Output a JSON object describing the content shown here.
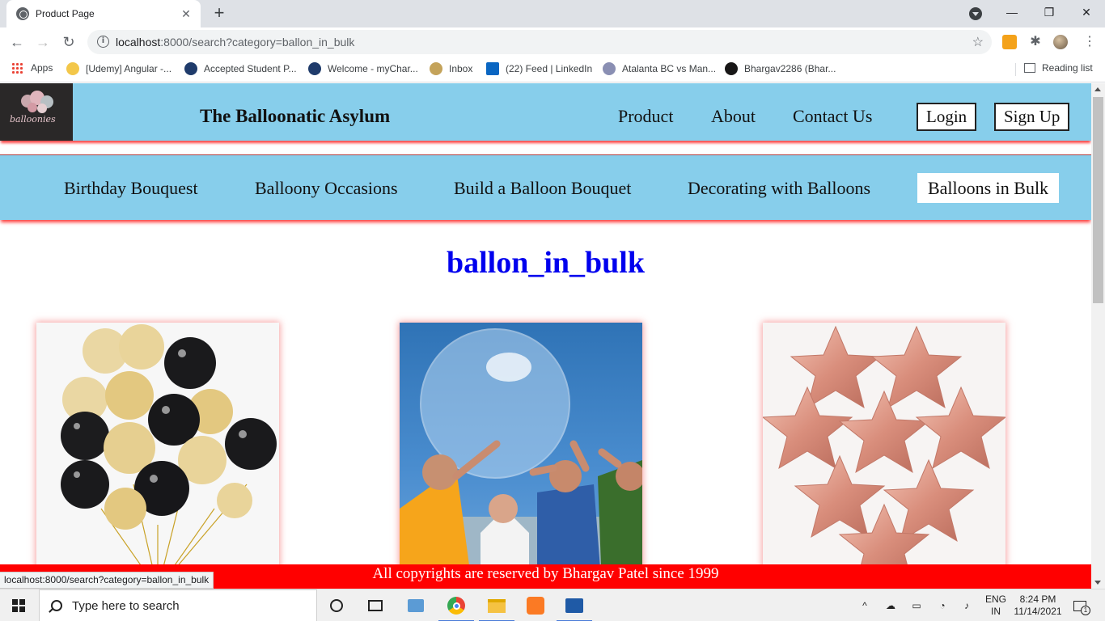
{
  "browser": {
    "tab_title": "Product Page",
    "tab_close": "✕",
    "new_tab": "+",
    "win_min": "—",
    "win_restore": "❐",
    "win_close": "✕",
    "back": "←",
    "forward": "→",
    "reload": "↻",
    "url_host": "localhost",
    "url_rest": ":8000/search?category=ballon_in_bulk",
    "star": "☆",
    "bookmarks": [
      {
        "label": "Apps"
      },
      {
        "label": "[Udemy] Angular -..."
      },
      {
        "label": "Accepted Student P..."
      },
      {
        "label": "Welcome - myChar..."
      },
      {
        "label": "Inbox"
      },
      {
        "label": "(22) Feed | LinkedIn"
      },
      {
        "label": "Atalanta BC vs Man..."
      },
      {
        "label": "Bhargav2286 (Bhar..."
      }
    ],
    "reading_list": "Reading list",
    "status_url": "localhost:8000/search?category=ballon_in_bulk"
  },
  "site": {
    "logo_text": "balloonies",
    "title": "The Balloonatic Asylum",
    "nav": [
      "Product",
      "About",
      "Contact Us"
    ],
    "login": "Login",
    "signup": "Sign Up",
    "categories": [
      "Birthday Bouquest",
      "Balloony Occasions",
      "Build a Balloon Bouquet",
      "Decorating with Balloons",
      "Balloons in Bulk"
    ],
    "active_category": "Balloons in Bulk",
    "heading": "ballon_in_bulk",
    "heading_color": "#0000ee",
    "header_color": "#87ceeb",
    "footer": "All copyrights are reserved by Bhargav Patel since 1999",
    "footer_color": "#ff0000"
  },
  "taskbar": {
    "search_placeholder": "Type here to search",
    "lang_top": "ENG",
    "lang_bottom": "IN",
    "time": "8:24 PM",
    "date": "11/14/2021",
    "notification_count": "1"
  }
}
